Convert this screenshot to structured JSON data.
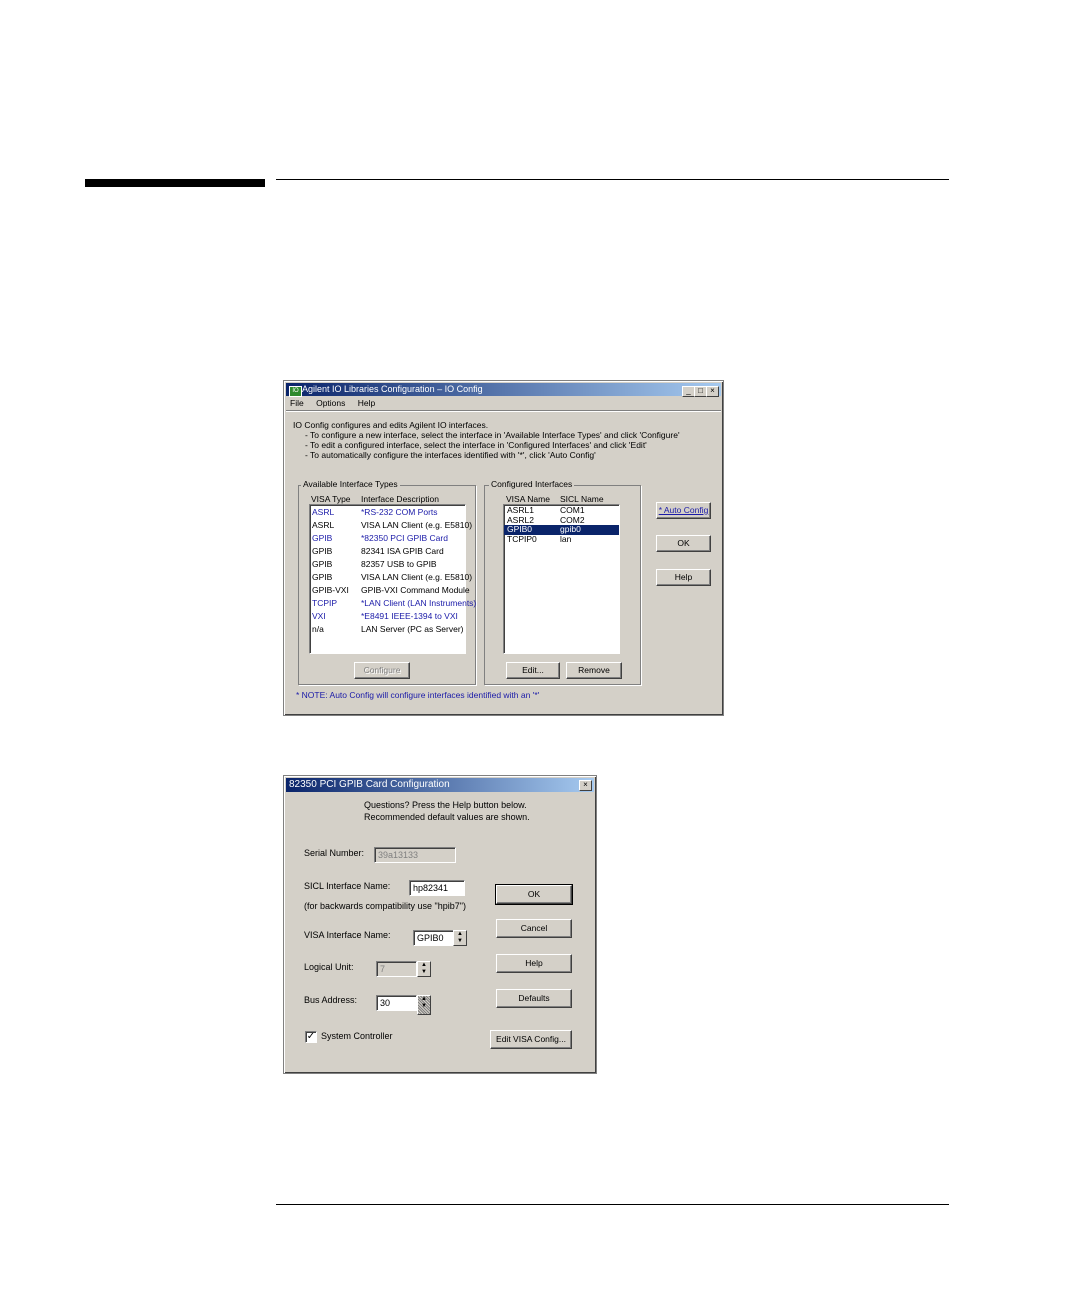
{
  "window1": {
    "title": "Agilent IO Libraries Configuration – IO Config",
    "app_icon": "agilent-io-icon",
    "menu": [
      "File",
      "Options",
      "Help"
    ],
    "intro": [
      "IO Config configures and edits Agilent IO interfaces.",
      "- To configure a new interface, select the interface in 'Available Interface Types'  and click 'Configure'",
      "- To edit a configured interface, select the interface in 'Configured Interfaces' and click 'Edit'",
      "- To automatically configure the interfaces identified with '*', click 'Auto Config'"
    ],
    "available": {
      "label": "Available Interface Types",
      "col_type": "VISA Type",
      "col_desc": "Interface Description",
      "rows": [
        {
          "type": "ASRL",
          "desc": "*RS-232 COM Ports",
          "auto": true
        },
        {
          "type": "ASRL",
          "desc": "VISA LAN Client (e.g. E5810)",
          "auto": false
        },
        {
          "type": "GPIB",
          "desc": "*82350 PCI GPIB Card",
          "auto": true
        },
        {
          "type": "GPIB",
          "desc": "82341 ISA GPIB Card",
          "auto": false
        },
        {
          "type": "GPIB",
          "desc": "82357 USB to GPIB",
          "auto": false
        },
        {
          "type": "GPIB",
          "desc": "VISA LAN Client (e.g. E5810)",
          "auto": false
        },
        {
          "type": "GPIB-VXI",
          "desc": "GPIB-VXI Command Module",
          "auto": false
        },
        {
          "type": "TCPIP",
          "desc": "*LAN Client (LAN Instruments)",
          "auto": true
        },
        {
          "type": "VXI",
          "desc": "*E8491 IEEE-1394 to VXI",
          "auto": true
        },
        {
          "type": "n/a",
          "desc": "LAN Server (PC as Server)",
          "auto": false
        }
      ],
      "configure_button": "Configure"
    },
    "configured": {
      "label": "Configured Interfaces",
      "col_visa": "VISA Name",
      "col_sicl": "SICL Name",
      "rows": [
        {
          "visa": "ASRL1",
          "sicl": "COM1",
          "selected": false
        },
        {
          "visa": "ASRL2",
          "sicl": "COM2",
          "selected": false
        },
        {
          "visa": "GPIB0",
          "sicl": "gpib0",
          "selected": true
        },
        {
          "visa": "TCPIP0",
          "sicl": "lan",
          "selected": false
        }
      ],
      "edit_button": "Edit...",
      "remove_button": "Remove"
    },
    "auto_config_button": "* Auto Config",
    "ok_button": "OK",
    "help_button": "Help",
    "note": "* NOTE: Auto Config will configure interfaces identified with an '*'"
  },
  "window2": {
    "title": "82350 PCI GPIB Card Configuration",
    "help_line1": "Questions?  Press the Help button below.",
    "help_line2": "Recommended default values are shown.",
    "serial_label": "Serial Number:",
    "serial_value": "39a13133",
    "sicl_label": "SICL Interface Name:",
    "sicl_value": "hp82341",
    "compat_note": "(for backwards compatibility use \"hpib7\")",
    "visa_label": "VISA Interface Name:",
    "visa_value": "GPIB0",
    "logical_label": "Logical Unit:",
    "logical_value": "7",
    "bus_label": "Bus Address:",
    "bus_value": "30",
    "system_controller_label": "System Controller",
    "system_controller_checked": true,
    "ok_button": "OK",
    "cancel_button": "Cancel",
    "help_button": "Help",
    "defaults_button": "Defaults",
    "edit_visa_button": "Edit VISA Config..."
  }
}
